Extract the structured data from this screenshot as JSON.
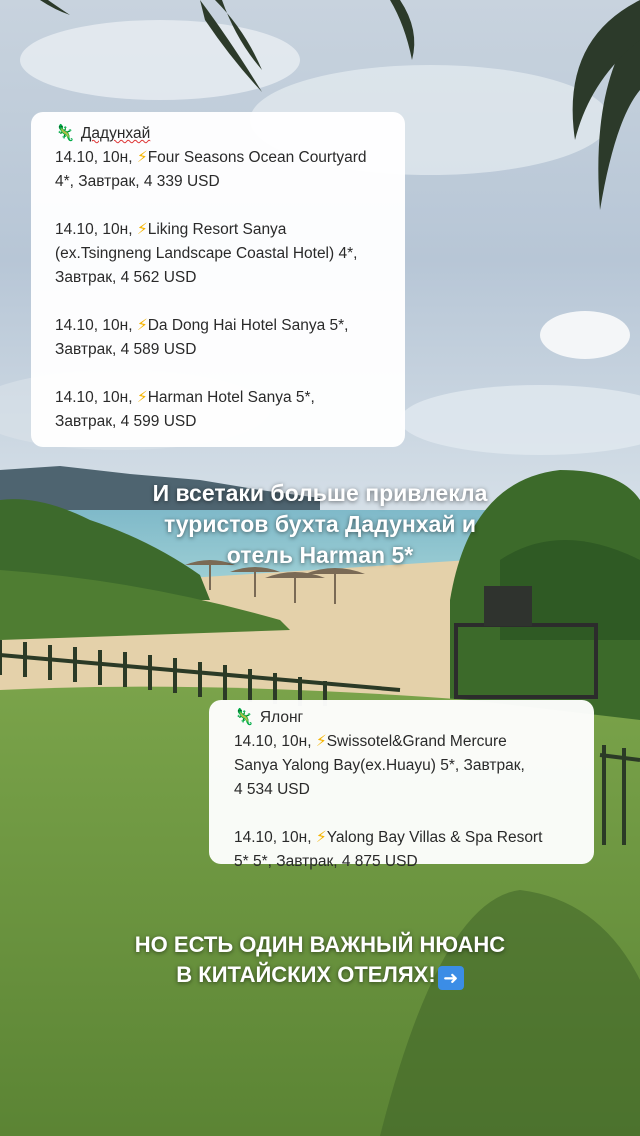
{
  "top_card": {
    "region": "Дадунхай",
    "offers": [
      {
        "dates": "14.10, 10н,",
        "text": "Four Seasons Ocean Courtyard",
        "text2": "4*, Завтрак, 4 339 USD"
      },
      {
        "dates": "14.10, 10н,",
        "text": "Liking Resort Sanya",
        "text2": "(ex.Tsingneng Landscape Coastal Hotel) 4*,",
        "text3": "Завтрак, 4 562 USD"
      },
      {
        "dates": "14.10, 10н,",
        "text": "Da Dong Hai Hotel Sanya 5*,",
        "text2": "Завтрак, 4 589 USD"
      },
      {
        "dates": "14.10, 10н,",
        "text": "Harman Hotel Sanya 5*,",
        "text2": "Завтрак, 4 599 USD"
      }
    ]
  },
  "headline_1": {
    "line1": "И всетаки больше привлекла",
    "line2": "туристов бухта Дадунхай и",
    "line3": "отель Harman 5*"
  },
  "bottom_card": {
    "region": "Ялонг",
    "offers": [
      {
        "dates": "14.10, 10н,",
        "text": "Swissotel&Grand Mercure",
        "text2": "Sanya Yalong Bay(ex.Huayu) 5*, Завтрак,",
        "text3": "4 534 USD"
      },
      {
        "dates": "14.10, 10н,",
        "text": "Yalong Bay Villas & Spa Resort",
        "text2": "5* 5*, Завтрак, 4 875 USD"
      }
    ]
  },
  "headline_2": {
    "line1": "НО ЕСТЬ ОДИН ВАЖНЫЙ НЮАНС",
    "line2": "В КИТАЙСКИХ ОТЕЛЯХ!",
    "arrow_icon": "right-arrow-icon"
  },
  "colors": {
    "sky": "#b8c8d8",
    "sea": "#8fc5cf",
    "sand": "#e6d3ad",
    "grass": "#6c9440",
    "icon_blue": "#3b8de6",
    "bolt": "#f5b400"
  }
}
